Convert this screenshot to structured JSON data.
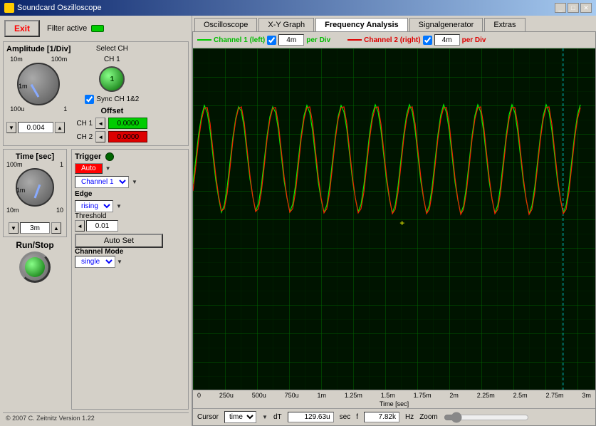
{
  "window": {
    "title": "Soundcard Oszilloscope"
  },
  "tabs": [
    {
      "id": "oscilloscope",
      "label": "Oscilloscope",
      "active": false
    },
    {
      "id": "xy-graph",
      "label": "X-Y Graph",
      "active": false
    },
    {
      "id": "frequency-analysis",
      "label": "Frequency Analysis",
      "active": true
    },
    {
      "id": "signalgenerator",
      "label": "Signalgenerator",
      "active": false
    },
    {
      "id": "extras",
      "label": "Extras",
      "active": false
    }
  ],
  "toolbar": {
    "exit_label": "Exit",
    "filter_label": "Filter active"
  },
  "amplitude": {
    "label": "Amplitude [1/Div]",
    "value": "0.004",
    "label_10m": "10m",
    "label_1m": "1m",
    "label_100m": "100m",
    "label_100u": "100u",
    "label_1": "1",
    "select_ch_label": "Select CH",
    "ch1_label": "CH 1",
    "sync_label": "Sync CH 1&2",
    "offset_label": "Offset",
    "ch1_offset_label": "CH 1",
    "ch1_offset_value": "0.0000",
    "ch2_offset_label": "CH 2",
    "ch2_offset_value": "0.0000"
  },
  "time": {
    "label": "Time [sec]",
    "value": "3m",
    "label_100m": "100m",
    "label_10m": "10m",
    "label_1m": "1m",
    "label_1": "1",
    "label_10": "10"
  },
  "trigger": {
    "label": "Trigger",
    "mode_label": "Auto",
    "channel_label": "Channel 1",
    "edge_label": "Edge",
    "edge_value": "rising",
    "threshold_label": "Threshold",
    "threshold_value": "0.01",
    "auto_set_label": "Auto Set",
    "channel_mode_label": "Channel Mode",
    "channel_mode_value": "single"
  },
  "run_stop": {
    "label": "Run/Stop"
  },
  "channels": {
    "ch1": {
      "label": "Channel 1 (left)",
      "per_div": "4m",
      "per_div_label": "per Div"
    },
    "ch2": {
      "label": "Channel 2 (right)",
      "per_div": "4m",
      "per_div_label": "per Div"
    }
  },
  "x_axis": {
    "labels": [
      "0",
      "250u",
      "500u",
      "750u",
      "1m",
      "1.25m",
      "1.5m",
      "1.75m",
      "2m",
      "2.25m",
      "2.5m",
      "2.75m",
      "3m"
    ],
    "unit_label": "Time [sec]"
  },
  "cursor": {
    "label": "Cursor",
    "mode": "time",
    "dt_label": "dT",
    "dt_value": "129.63u",
    "dt_unit": "sec",
    "f_label": "f",
    "f_value": "7.82k",
    "f_unit": "Hz",
    "zoom_label": "Zoom"
  },
  "copyright": "© 2007  C. Zeitnitz Version 1.22"
}
